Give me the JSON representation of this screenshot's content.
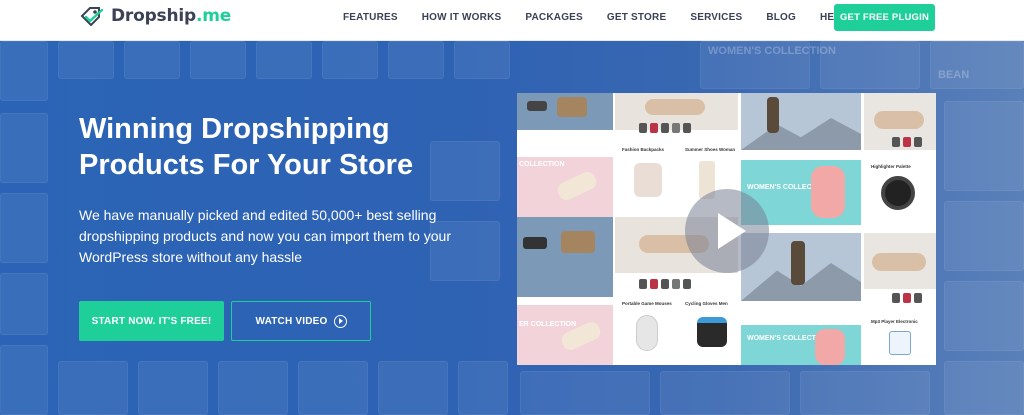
{
  "header": {
    "logo_text": "Dropship",
    "logo_suffix": ".me",
    "nav": [
      "FEATURES",
      "HOW IT WORKS",
      "PACKAGES",
      "GET STORE",
      "SERVICES",
      "BLOG",
      "HELP"
    ],
    "cta": "GET FREE PLUGIN"
  },
  "hero": {
    "title_line1": "Winning Dropshipping",
    "title_line2": "Products For Your Store",
    "subtitle": "We have manually picked and edited 50,000+ best selling dropshipping products and now you can import them to your WordPress store without any hassle",
    "start_button": "START NOW. IT'S FREE!",
    "video_button": "WATCH VIDEO"
  },
  "video_panel": {
    "labels": {
      "fashion_backpacks": "Fashion Backpacks",
      "summer_shoes": "Summer Shoes Woman",
      "highlighter": "Highlighter Palette",
      "game_mouses": "Portable Game Mouses",
      "cycling_gloves": "Cycling Gloves Men",
      "mp3_player": "Mp3 Player Electronic",
      "womens_collection": "WOMEN'S COLLECTION",
      "collection_partial": "COLLECTION",
      "er_collection": "ER COLLECTION"
    }
  },
  "background": {
    "womens_collection": "WOMEN'S COLLECTION",
    "bean": "BEAN"
  },
  "colors": {
    "accent": "#1fcf9a",
    "hero_blue": "#2e62b3",
    "nav_text": "#3b4255"
  }
}
